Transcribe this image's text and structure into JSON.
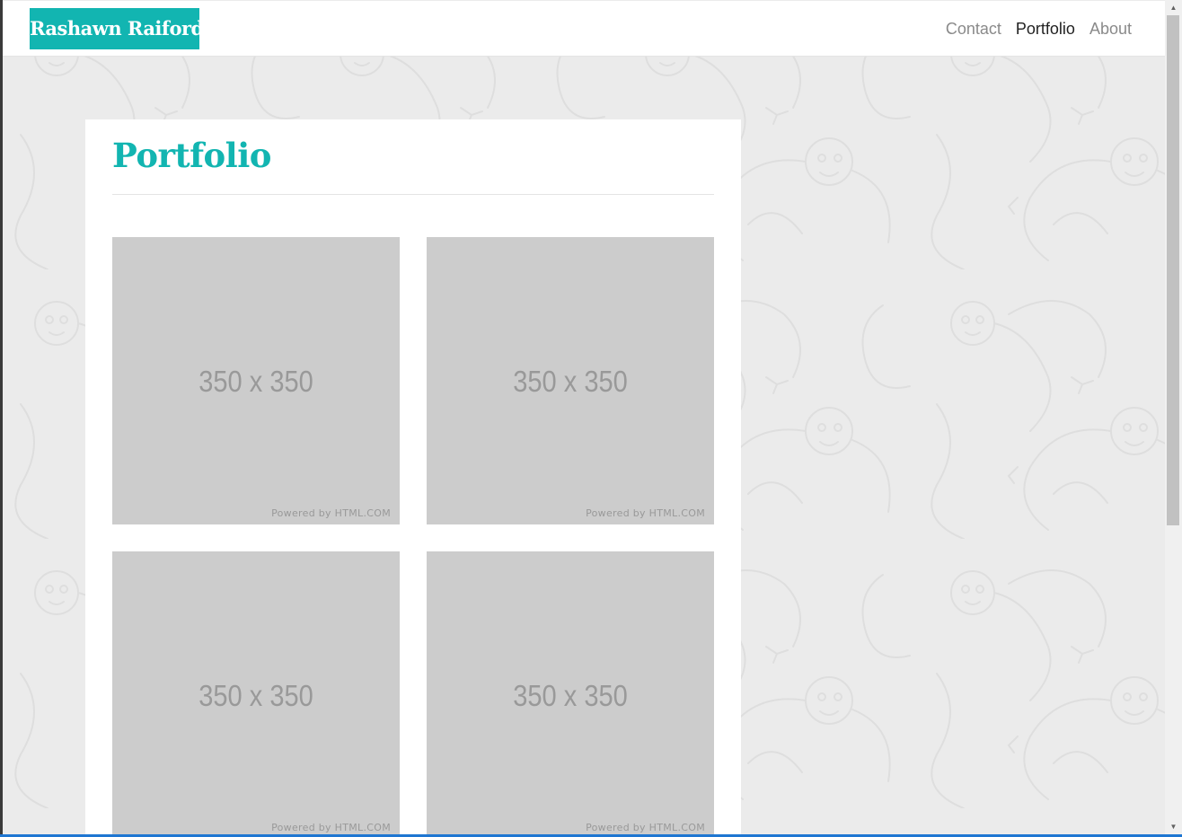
{
  "brand": {
    "name": "Rashawn Raiford",
    "color": "#12b5b1"
  },
  "nav": {
    "items": [
      {
        "label": "Contact",
        "active": false
      },
      {
        "label": "Portfolio",
        "active": true
      },
      {
        "label": "About",
        "active": false
      }
    ]
  },
  "page": {
    "title": "Portfolio",
    "thumbnails": [
      {
        "size_text": "350 x 350",
        "credit": "Powered by HTML.COM"
      },
      {
        "size_text": "350 x 350",
        "credit": "Powered by HTML.COM"
      },
      {
        "size_text": "350 x 350",
        "credit": "Powered by HTML.COM"
      },
      {
        "size_text": "350 x 350",
        "credit": "Powered by HTML.COM"
      }
    ]
  },
  "scrollbar": {
    "up_icon": "scroll-up-arrow-icon",
    "down_icon": "scroll-down-arrow-icon"
  }
}
